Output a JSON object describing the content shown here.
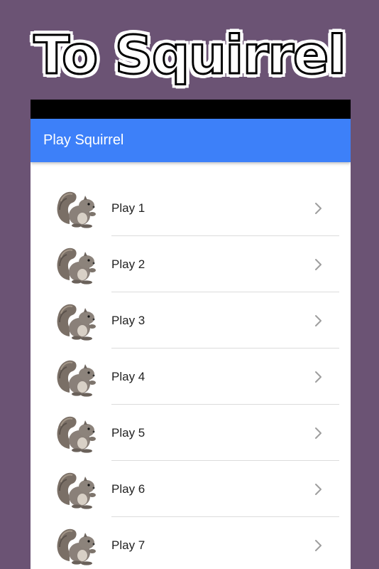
{
  "promo": {
    "title": "To Squirrel"
  },
  "app": {
    "title": "Play Squirrel"
  },
  "list": {
    "items": [
      {
        "label": "Play 1",
        "icon": "squirrel-icon",
        "trailing_icon": "chevron-right-icon"
      },
      {
        "label": "Play 2",
        "icon": "squirrel-icon",
        "trailing_icon": "chevron-right-icon"
      },
      {
        "label": "Play 3",
        "icon": "squirrel-icon",
        "trailing_icon": "chevron-right-icon"
      },
      {
        "label": "Play 4",
        "icon": "squirrel-icon",
        "trailing_icon": "chevron-right-icon"
      },
      {
        "label": "Play 5",
        "icon": "squirrel-icon",
        "trailing_icon": "chevron-right-icon"
      },
      {
        "label": "Play 6",
        "icon": "squirrel-icon",
        "trailing_icon": "chevron-right-icon"
      },
      {
        "label": "Play 7",
        "icon": "squirrel-icon",
        "trailing_icon": "chevron-right-icon"
      }
    ]
  },
  "colors": {
    "background": "#6b5374",
    "app_bar": "#3d80f9",
    "status_bar": "#000000"
  }
}
